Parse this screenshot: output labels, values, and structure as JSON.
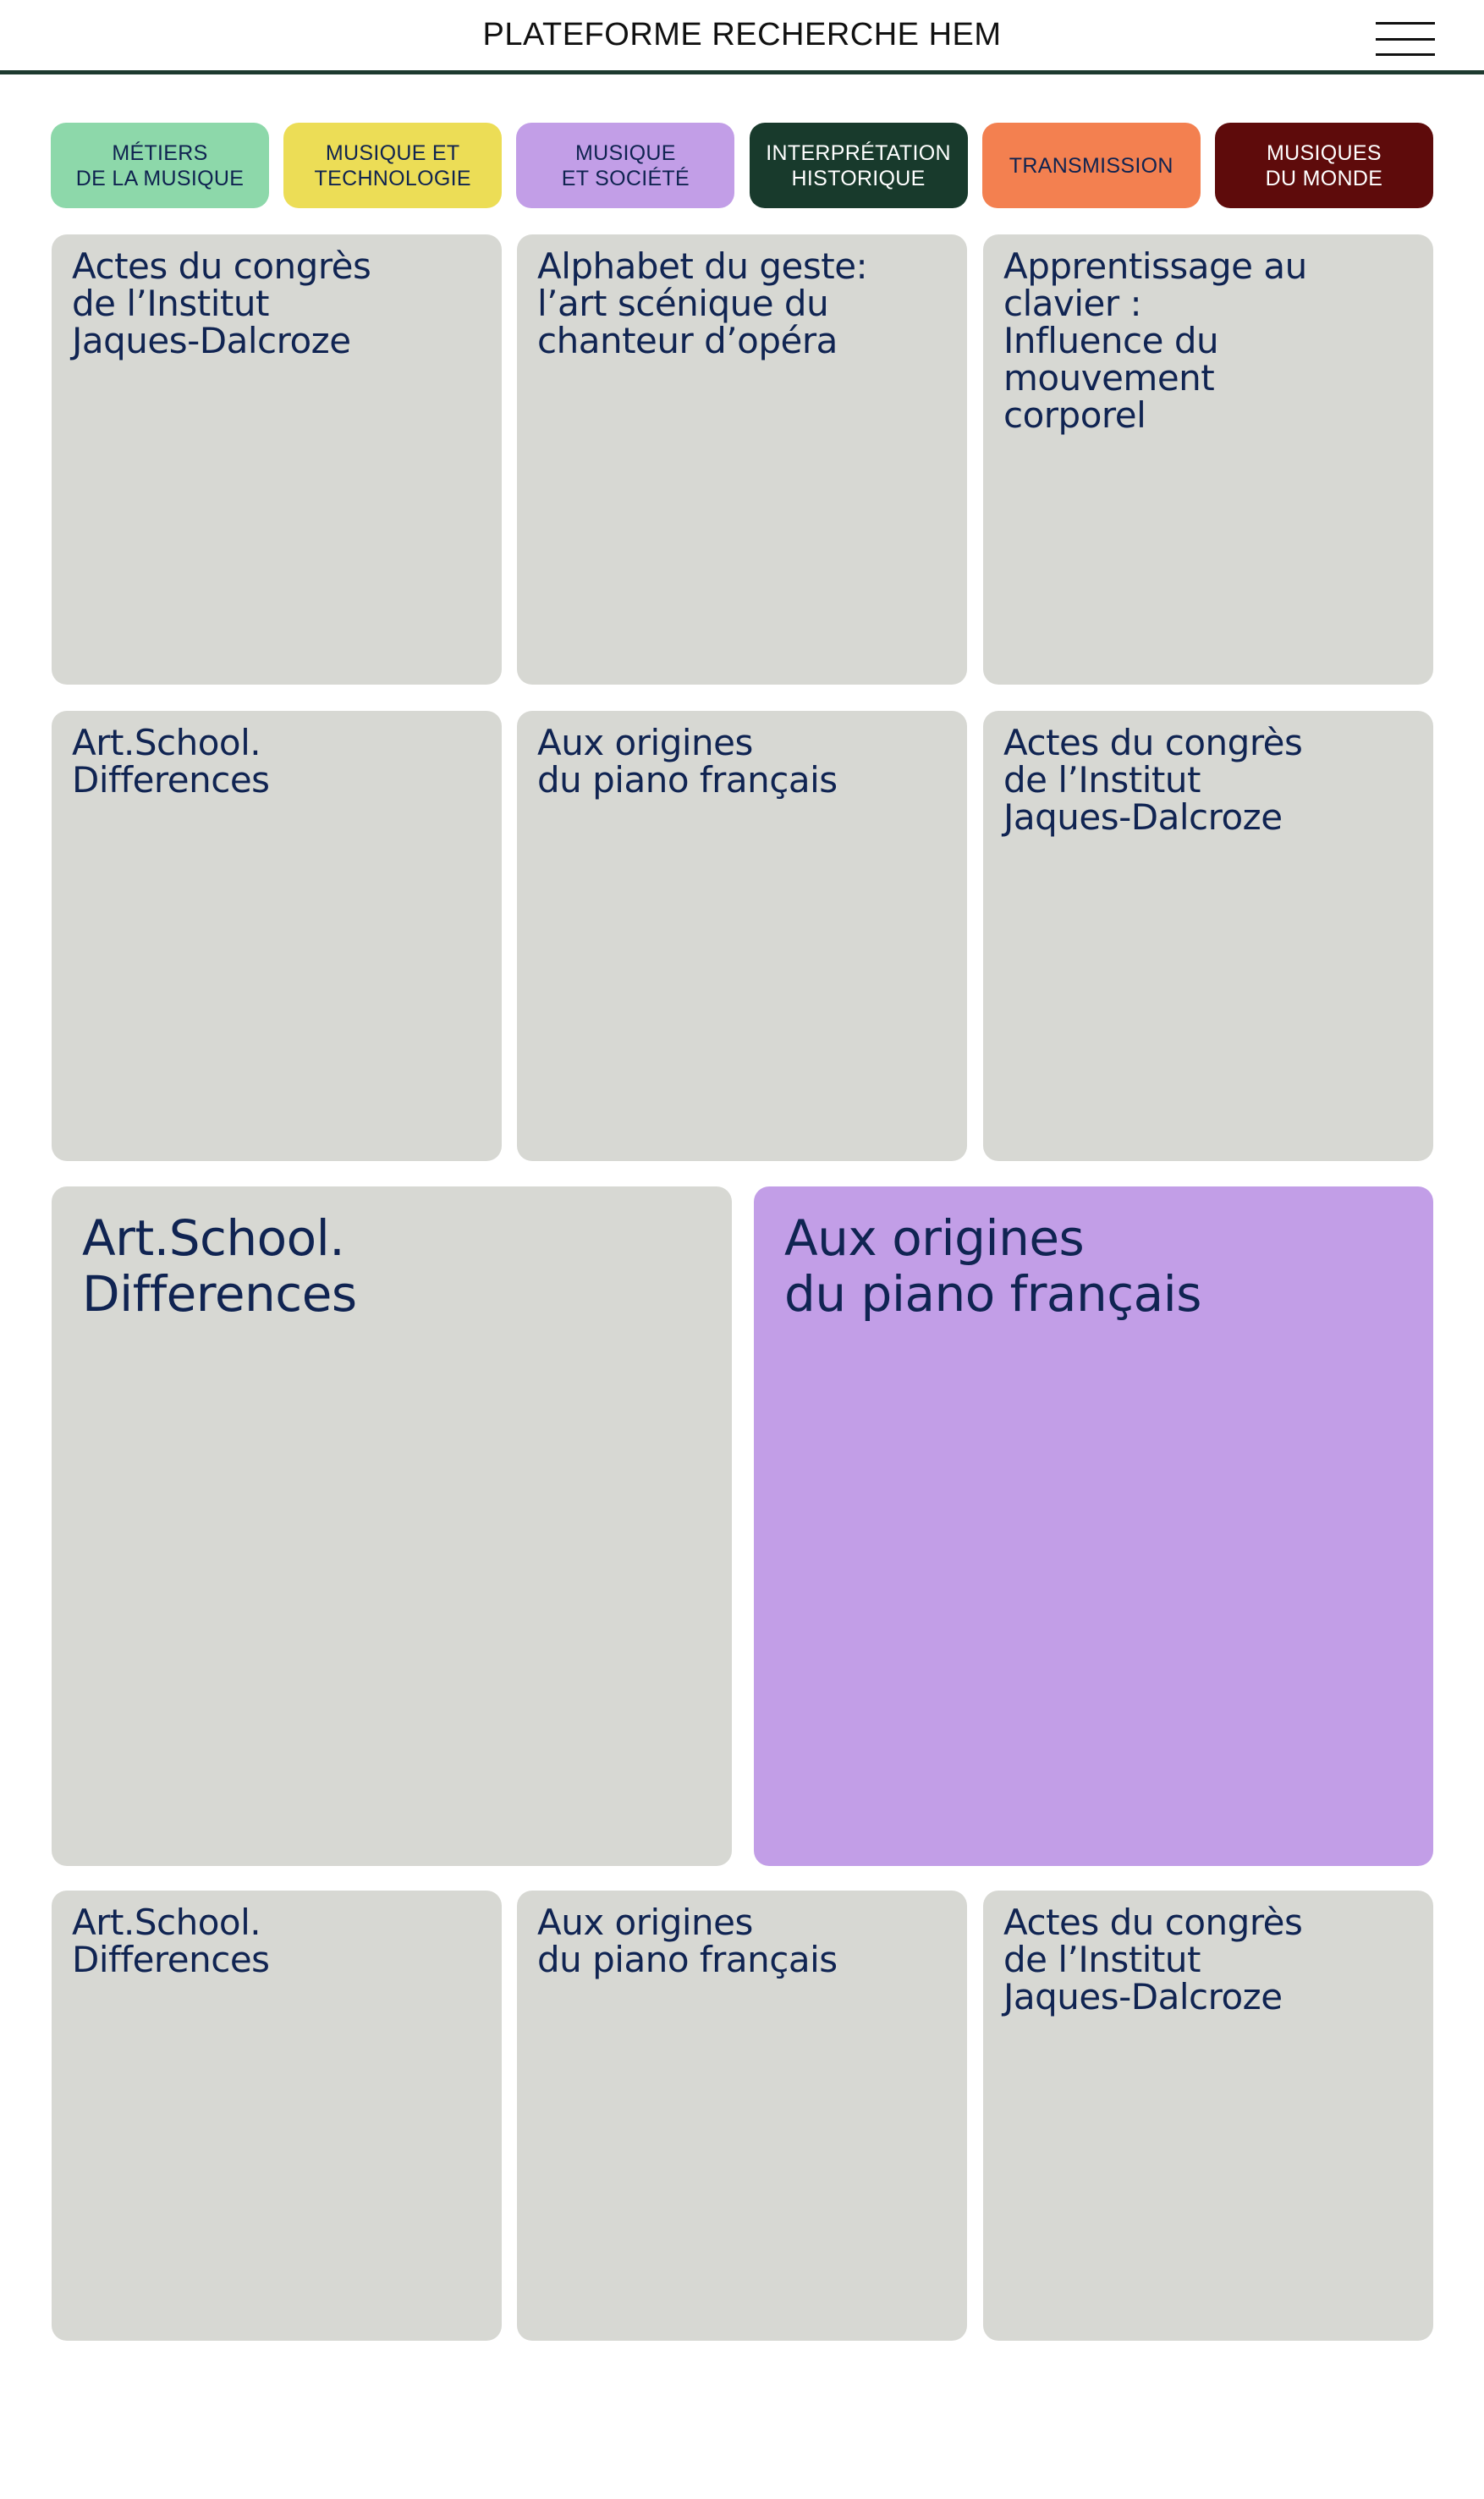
{
  "header": {
    "title": "PLATEFORME RECHERCHE HEM",
    "menu_icon": "hamburger-menu-icon"
  },
  "categories": [
    {
      "label": "MÉTIERS\nDE LA MUSIQUE",
      "color": "#8dd8aa",
      "text_color": "#0f2350"
    },
    {
      "label": "MUSIQUE ET\nTECHNOLOGIE",
      "color": "#ecdd56",
      "text_color": "#0f2350"
    },
    {
      "label": "MUSIQUE\nET SOCIÉTÉ",
      "color": "#c29ee7",
      "text_color": "#0f2350"
    },
    {
      "label": "INTERPRÉTATION\nHISTORIQUE",
      "color": "#183a2c",
      "text_color": "#ffffff"
    },
    {
      "label": "TRANSMISSION",
      "color": "#f38050",
      "text_color": "#0f2350"
    },
    {
      "label": "MUSIQUES\nDU MONDE",
      "color": "#5e0b0b",
      "text_color": "#ffffff"
    }
  ],
  "cards": [
    {
      "title": "Actes du congrès\nde l’Institut\nJaques-Dalcroze"
    },
    {
      "title": "Alphabet du geste:\nl’art scénique du\nchanteur d’opéra"
    },
    {
      "title": "Apprentissage au clavier :\nInfluence du mouvement\ncorporel"
    },
    {
      "title": "Art.School.\nDifferences"
    },
    {
      "title": "Aux origines\ndu piano français"
    },
    {
      "title": "Actes du congrès\nde l’Institut\nJaques-Dalcroze"
    },
    {
      "title": "Art.School.\nDifferences"
    },
    {
      "title": "Aux origines\ndu piano français"
    },
    {
      "title": "Art.School.\nDifferences"
    },
    {
      "title": "Aux origines\ndu piano français"
    },
    {
      "title": "Actes du congrès\nde l’Institut\nJaques-Dalcroze"
    }
  ],
  "colors": {
    "card_default": "#d7d8d3",
    "card_highlight": "#c29ee7",
    "header_rule": "#1d3a2f",
    "text": "#102452"
  }
}
